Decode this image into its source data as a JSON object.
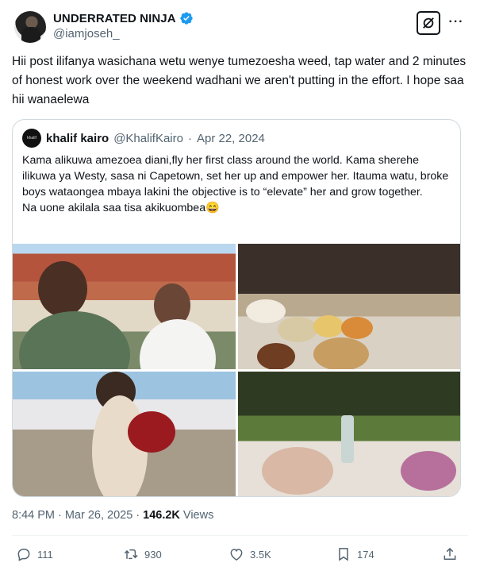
{
  "author": {
    "display_name": "UNDERRATED NINJA",
    "handle": "@iamjoseh_",
    "verified_color": "#1d9bf0"
  },
  "tweet": {
    "text": "Hii post ilifanya wasichana wetu wenye tumezoesha weed, tap water and 2 minutes of honest work over the weekend wadhani we aren't putting in the effort. I hope saa hii wanaelewa"
  },
  "quote": {
    "display_name": "khalif kairo",
    "handle": "@KhalifKairo",
    "date": "Apr 22, 2024",
    "text": "Kama alikuwa amezoea diani,fly her first class  around the world. Kama sherehe ilikuwa ya Westy, sasa ni Capetown, set her up and empower her. Itauma watu, broke boys wataongea mbaya lakini the objective is to “elevate” her and grow together.\nNa uone akilala saa tisa akikuombea😄",
    "avatar_text": "khalif"
  },
  "meta": {
    "time": "8:44 PM",
    "date": "Mar 26, 2025",
    "views_count": "146.2K",
    "views_label": "Views"
  },
  "actions": {
    "replies": "111",
    "reposts": "930",
    "likes": "3.5K",
    "bookmarks": "174"
  },
  "icons": [
    "verified-badge-icon",
    "grok-icon",
    "more-icon",
    "reply-icon",
    "repost-icon",
    "like-icon",
    "bookmark-icon",
    "share-icon"
  ]
}
